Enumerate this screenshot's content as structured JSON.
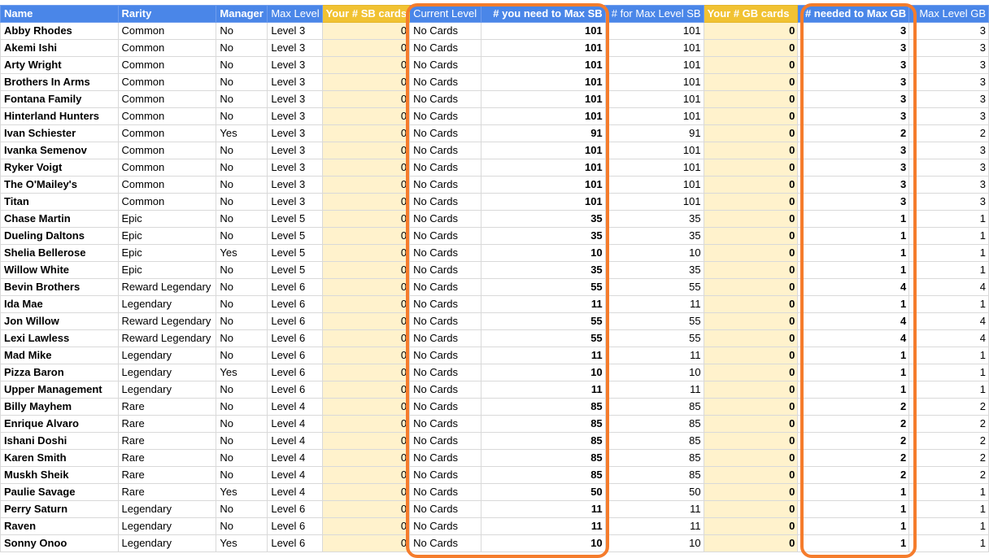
{
  "headers": [
    "Name",
    "Rarity",
    "Manager",
    "Max Level",
    "Your # SB cards",
    "Current Level",
    "# you need to Max SB",
    "# for Max Level SB",
    "Your # GB cards",
    "# needed to Max GB",
    "Max Level GB"
  ],
  "rows": [
    [
      "Abby Rhodes",
      "Common",
      "No",
      "Level 3",
      "0",
      "No Cards",
      "101",
      "101",
      "0",
      "3",
      "3"
    ],
    [
      "Akemi Ishi",
      "Common",
      "No",
      "Level 3",
      "0",
      "No Cards",
      "101",
      "101",
      "0",
      "3",
      "3"
    ],
    [
      "Arty Wright",
      "Common",
      "No",
      "Level 3",
      "0",
      "No Cards",
      "101",
      "101",
      "0",
      "3",
      "3"
    ],
    [
      "Brothers In Arms",
      "Common",
      "No",
      "Level 3",
      "0",
      "No Cards",
      "101",
      "101",
      "0",
      "3",
      "3"
    ],
    [
      "Fontana Family",
      "Common",
      "No",
      "Level 3",
      "0",
      "No Cards",
      "101",
      "101",
      "0",
      "3",
      "3"
    ],
    [
      "Hinterland Hunters",
      "Common",
      "No",
      "Level 3",
      "0",
      "No Cards",
      "101",
      "101",
      "0",
      "3",
      "3"
    ],
    [
      "Ivan Schiester",
      "Common",
      "Yes",
      "Level 3",
      "0",
      "No Cards",
      "91",
      "91",
      "0",
      "2",
      "2"
    ],
    [
      "Ivanka Semenov",
      "Common",
      "No",
      "Level 3",
      "0",
      "No Cards",
      "101",
      "101",
      "0",
      "3",
      "3"
    ],
    [
      "Ryker Voigt",
      "Common",
      "No",
      "Level 3",
      "0",
      "No Cards",
      "101",
      "101",
      "0",
      "3",
      "3"
    ],
    [
      "The O'Mailey's",
      "Common",
      "No",
      "Level 3",
      "0",
      "No Cards",
      "101",
      "101",
      "0",
      "3",
      "3"
    ],
    [
      "Titan",
      "Common",
      "No",
      "Level 3",
      "0",
      "No Cards",
      "101",
      "101",
      "0",
      "3",
      "3"
    ],
    [
      "Chase Martin",
      "Epic",
      "No",
      "Level 5",
      "0",
      "No Cards",
      "35",
      "35",
      "0",
      "1",
      "1"
    ],
    [
      "Dueling Daltons",
      "Epic",
      "No",
      "Level 5",
      "0",
      "No Cards",
      "35",
      "35",
      "0",
      "1",
      "1"
    ],
    [
      "Shelia Bellerose",
      "Epic",
      "Yes",
      "Level 5",
      "0",
      "No Cards",
      "10",
      "10",
      "0",
      "1",
      "1"
    ],
    [
      "Willow White",
      "Epic",
      "No",
      "Level 5",
      "0",
      "No Cards",
      "35",
      "35",
      "0",
      "1",
      "1"
    ],
    [
      "Bevin Brothers",
      "Reward Legendary",
      "No",
      "Level 6",
      "0",
      "No Cards",
      "55",
      "55",
      "0",
      "4",
      "4"
    ],
    [
      "Ida Mae",
      "Legendary",
      "No",
      "Level 6",
      "0",
      "No Cards",
      "11",
      "11",
      "0",
      "1",
      "1"
    ],
    [
      "Jon Willow",
      "Reward Legendary",
      "No",
      "Level 6",
      "0",
      "No Cards",
      "55",
      "55",
      "0",
      "4",
      "4"
    ],
    [
      "Lexi Lawless",
      "Reward Legendary",
      "No",
      "Level 6",
      "0",
      "No Cards",
      "55",
      "55",
      "0",
      "4",
      "4"
    ],
    [
      "Mad Mike",
      "Legendary",
      "No",
      "Level 6",
      "0",
      "No Cards",
      "11",
      "11",
      "0",
      "1",
      "1"
    ],
    [
      "Pizza Baron",
      "Legendary",
      "Yes",
      "Level 6",
      "0",
      "No Cards",
      "10",
      "10",
      "0",
      "1",
      "1"
    ],
    [
      "Upper Management",
      "Legendary",
      "No",
      "Level 6",
      "0",
      "No Cards",
      "11",
      "11",
      "0",
      "1",
      "1"
    ],
    [
      "Billy Mayhem",
      "Rare",
      "No",
      "Level 4",
      "0",
      "No Cards",
      "85",
      "85",
      "0",
      "2",
      "2"
    ],
    [
      "Enrique Alvaro",
      "Rare",
      "No",
      "Level 4",
      "0",
      "No Cards",
      "85",
      "85",
      "0",
      "2",
      "2"
    ],
    [
      "Ishani Doshi",
      "Rare",
      "No",
      "Level 4",
      "0",
      "No Cards",
      "85",
      "85",
      "0",
      "2",
      "2"
    ],
    [
      "Karen Smith",
      "Rare",
      "No",
      "Level 4",
      "0",
      "No Cards",
      "85",
      "85",
      "0",
      "2",
      "2"
    ],
    [
      "Muskh Sheik",
      "Rare",
      "No",
      "Level 4",
      "0",
      "No Cards",
      "85",
      "85",
      "0",
      "2",
      "2"
    ],
    [
      "Paulie Savage",
      "Rare",
      "Yes",
      "Level 4",
      "0",
      "No Cards",
      "50",
      "50",
      "0",
      "1",
      "1"
    ],
    [
      "Perry Saturn",
      "Legendary",
      "No",
      "Level 6",
      "0",
      "No Cards",
      "11",
      "11",
      "0",
      "1",
      "1"
    ],
    [
      "Raven",
      "Legendary",
      "No",
      "Level 6",
      "0",
      "No Cards",
      "11",
      "11",
      "0",
      "1",
      "1"
    ],
    [
      "Sonny Onoo",
      "Legendary",
      "Yes",
      "Level 6",
      "0",
      "No Cards",
      "10",
      "10",
      "0",
      "1",
      "1"
    ]
  ],
  "colors": {
    "header_blue": "#4a86e8",
    "header_yellow": "#f1c232",
    "cell_yellow": "#fff2cc",
    "highlight": "#f57c2c"
  }
}
